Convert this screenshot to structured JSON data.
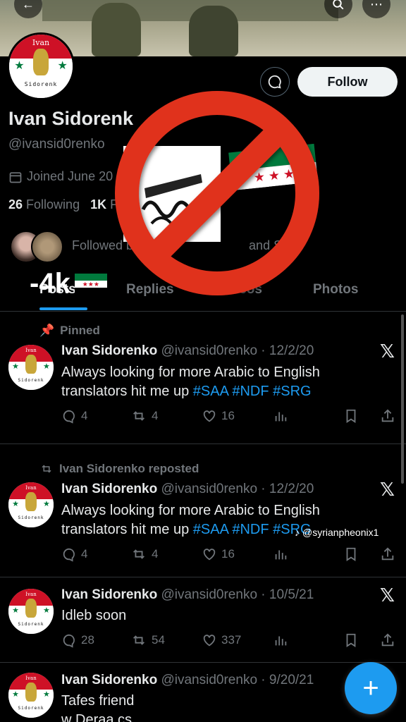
{
  "profile": {
    "display_name": "Ivan Sidorenk",
    "handle": "@ivansid0renko",
    "joined": "Joined June 20",
    "following_count": "26",
    "following_label": "Following",
    "followers_count": "1K",
    "followers_label": "F",
    "followed_by": "Followed b",
    "followed_by_tail": "and STA",
    "avatar_top_text": "Ivan",
    "avatar_bottom_text": "Sidorenk",
    "follow_label": "Follow"
  },
  "tabs": [
    {
      "label": "Posts"
    },
    {
      "label": "Replies"
    },
    {
      "label": "Videos"
    },
    {
      "label": "Photos"
    }
  ],
  "overlay": {
    "count_text": "-4k",
    "watermark": "@syrianpheonix1"
  },
  "posts": [
    {
      "social": "Pinned",
      "name": "Ivan Sidorenko",
      "handle": "@ivansid0renko",
      "date": "· 12/2/20",
      "text": "Always looking for more Arabic to English translators hit me up",
      "tags": "#SAA #NDF #SRG",
      "replies": "4",
      "reposts": "4",
      "likes": "16"
    },
    {
      "social": "Ivan Sidorenko reposted",
      "name": "Ivan Sidorenko",
      "handle": "@ivansid0renko",
      "date": "· 12/2/20",
      "text": "Always looking for more Arabic to English translators hit me up",
      "tags": "#SAA #NDF #SRG",
      "replies": "4",
      "reposts": "4",
      "likes": "16"
    },
    {
      "name": "Ivan Sidorenko",
      "handle": "@ivansid0renko",
      "date": "· 10/5/21",
      "text": "Idleb soon",
      "replies": "28",
      "reposts": "54",
      "likes": "337"
    },
    {
      "name": "Ivan Sidorenko",
      "handle": "@ivansid0renko",
      "date": "· 9/20/21",
      "text": "Tafes friend",
      "text2": "w Deraa cs"
    }
  ],
  "colors": {
    "accent": "#1d9bf0",
    "no_symbol": "#e0321f",
    "background": "#000000"
  },
  "icons": [
    "search-icon",
    "more-icon",
    "message-icon",
    "calendar-icon",
    "pin-icon",
    "repost-icon",
    "reply-icon",
    "like-icon",
    "views-icon",
    "bookmark-icon",
    "share-icon",
    "x-logo-icon",
    "tiktok-icon",
    "plus-icon"
  ]
}
